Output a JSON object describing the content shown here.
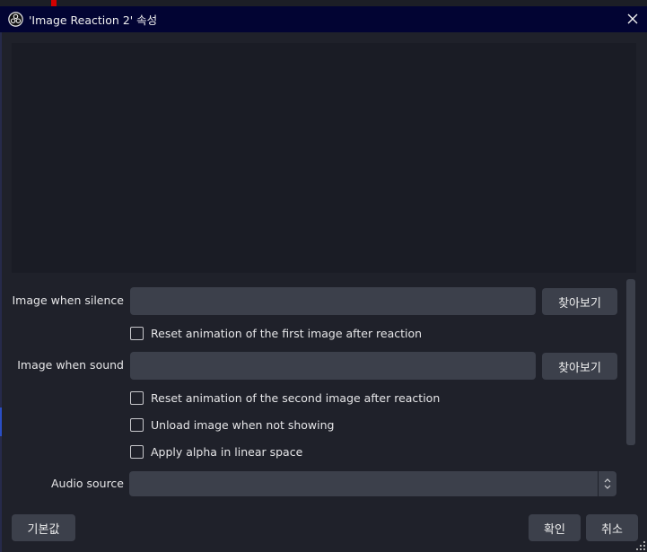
{
  "window": {
    "title": "'Image Reaction 2' 속성",
    "app_icon": "obs-logo-icon",
    "close_icon": "close-icon"
  },
  "properties": {
    "image_silence": {
      "label": "Image when silence",
      "value": "",
      "browse_label": "찾아보기"
    },
    "reset_first": {
      "label": "Reset animation of the first image after reaction",
      "checked": false
    },
    "image_sound": {
      "label": "Image when sound",
      "value": "",
      "browse_label": "찾아보기"
    },
    "reset_second": {
      "label": "Reset animation of the second image after reaction",
      "checked": false
    },
    "unload": {
      "label": "Unload image when not showing",
      "checked": false
    },
    "linear_alpha": {
      "label": "Apply alpha in linear space",
      "checked": false
    },
    "audio_source": {
      "label": "Audio source",
      "selected": ""
    }
  },
  "footer": {
    "defaults_label": "기본값",
    "ok_label": "확인",
    "cancel_label": "취소"
  },
  "colors": {
    "titlebar_bg": "#020433",
    "dialog_bg": "#1f212a",
    "control_bg": "#3c404b",
    "preview_bg": "#1a1c25"
  }
}
